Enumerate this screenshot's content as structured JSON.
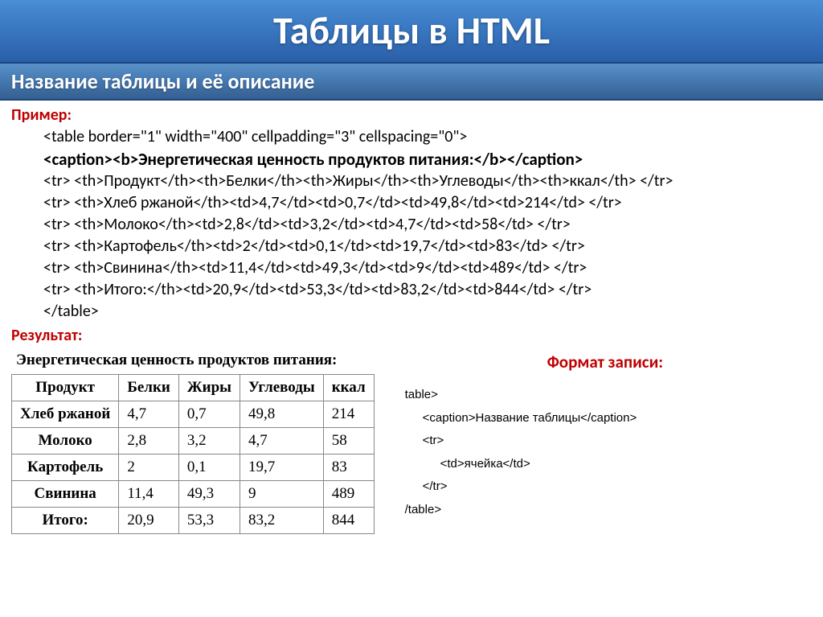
{
  "header": {
    "title": "Таблицы в HTML",
    "subtitle": "Название таблицы и её описание"
  },
  "labels": {
    "example": "Пример:",
    "result": "Результат:",
    "format": "Формат записи:"
  },
  "code": {
    "line1": "<table border=\"1\" width=\"400\" cellpadding=\"3\" cellspacing=\"0\">",
    "line2": "<caption><b>Энергетическая ценность продуктов питания:</b></caption>",
    "line3": "<tr> <th>Продукт</th><th>Белки</th><th>Жиры</th><th>Углеводы</th><th>ккал</th> </tr>",
    "line4": "<tr> <th>Хлеб ржаной</th><td>4,7</td><td>0,7</td><td>49,8</td><td>214</td> </tr>",
    "line5": "<tr> <th>Молоко</th><td>2,8</td><td>3,2</td><td>4,7</td><td>58</td> </tr>",
    "line6": "<tr> <th>Картофель</th><td>2</td><td>0,1</td><td>19,7</td><td>83</td> </tr>",
    "line7": "<tr> <th>Свинина</th><td>11,4</td><td>49,3</td><td>9</td><td>489</td> </tr>",
    "line8": "<tr> <th>Итого:</th><td>20,9</td><td>53,3</td><td>83,2</td><td>844</td> </tr>",
    "line9": "</table>"
  },
  "table": {
    "caption": "Энергетическая ценность продуктов питания:",
    "headers": [
      "Продукт",
      "Белки",
      "Жиры",
      "Углеводы",
      "ккал"
    ],
    "rows": [
      {
        "name": "Хлеб ржаной",
        "c1": "4,7",
        "c2": "0,7",
        "c3": "49,8",
        "c4": "214"
      },
      {
        "name": "Молоко",
        "c1": "2,8",
        "c2": "3,2",
        "c3": "4,7",
        "c4": "58"
      },
      {
        "name": "Картофель",
        "c1": "2",
        "c2": "0,1",
        "c3": "19,7",
        "c4": "83"
      },
      {
        "name": "Свинина",
        "c1": "11,4",
        "c2": "49,3",
        "c3": "9",
        "c4": "489"
      },
      {
        "name": "Итого:",
        "c1": "20,9",
        "c2": "53,3",
        "c3": "83,2",
        "c4": "844"
      }
    ]
  },
  "format": {
    "l1": "table>",
    "l2": "<caption>Название таблицы</caption>",
    "l3": "<tr>",
    "l4": "<td>ячейка</td>",
    "l5": "</tr>",
    "l6": "/table>"
  }
}
